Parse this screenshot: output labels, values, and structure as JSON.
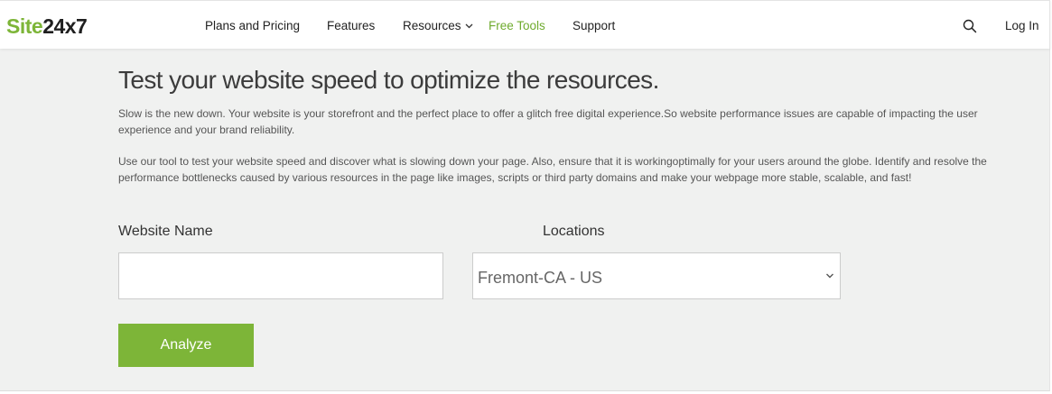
{
  "brand": {
    "logo_site": "Site",
    "logo_num": "24x7",
    "brand_green": "#7db538",
    "brand_dark": "#1f1f1f"
  },
  "nav": {
    "items": [
      {
        "label": "Plans and Pricing",
        "active": false
      },
      {
        "label": "Features",
        "active": false
      },
      {
        "label": "Resources",
        "active": false,
        "has_dropdown": true
      },
      {
        "label": "Free Tools",
        "active": true
      },
      {
        "label": "Support",
        "active": false
      }
    ],
    "active_color": "#6fab2e",
    "search_icon": "search-icon",
    "login_label": "Log In"
  },
  "main": {
    "background": "#f0f1f0",
    "title": "Test your website speed to optimize the resources.",
    "paragraph1": "Slow is the new down. Your website is your storefront and the perfect place to offer a glitch free digital experience.So website performance issues are capable of impacting the user experience and your brand reliability.",
    "paragraph2": "Use our tool to test your website speed and discover what is slowing down your page. Also, ensure that it is workingoptimally for your users around the globe. Identify and resolve the performance bottlenecks caused by various resources in the page like images, scripts or third party domains and make your webpage more stable, scalable, and fast!"
  },
  "form": {
    "website_label": "Website Name",
    "website_value": "",
    "website_placeholder": "",
    "locations_label": "Locations",
    "location_selected": "Fremont-CA - US",
    "dropdown_icon": "chevron-down-icon",
    "analyze_label": "Analyze",
    "analyze_color": "#7db538"
  }
}
